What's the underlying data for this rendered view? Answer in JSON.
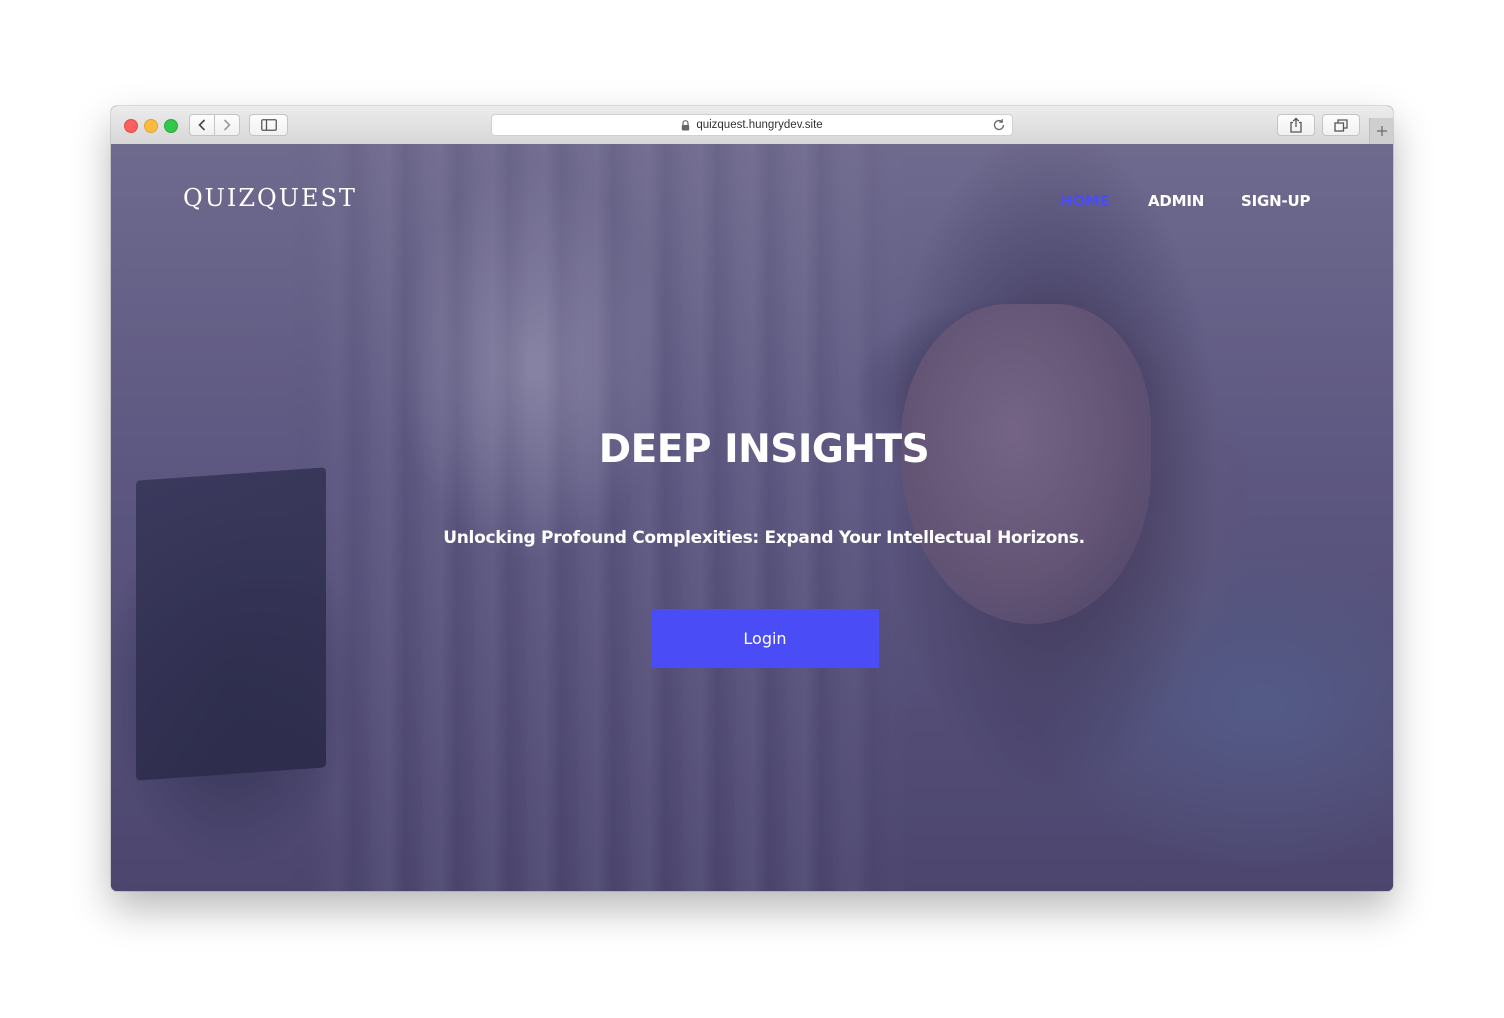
{
  "browser": {
    "url": "quizquest.hungrydev.site",
    "icons": {
      "back": "chevron-left-icon",
      "forward": "chevron-right-icon",
      "sidebar": "sidebar-icon",
      "lock": "lock-icon",
      "reload": "reload-icon",
      "share": "share-icon",
      "tabs": "tabs-icon",
      "new_tab": "plus-icon"
    }
  },
  "site": {
    "logo": "QUIZQUEST",
    "nav": [
      {
        "label": "HOME",
        "active": true
      },
      {
        "label": "ADMIN",
        "active": false
      },
      {
        "label": "SIGN-UP",
        "active": false
      }
    ],
    "hero": {
      "title": "DEEP INSIGHTS",
      "subtitle": "Unlocking Profound Complexities: Expand Your Intellectual Horizons.",
      "button": "Login"
    }
  },
  "colors": {
    "accent": "#4a4cf6",
    "overlay": "#484278"
  }
}
